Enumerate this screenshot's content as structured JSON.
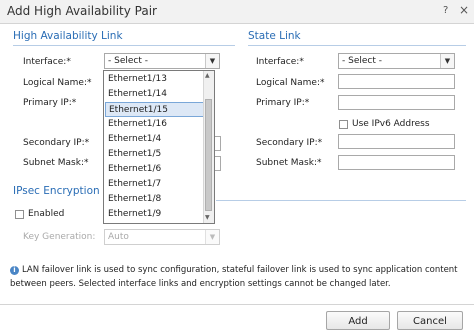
{
  "window": {
    "title": "Add High Availability Pair",
    "help_glyph": "?",
    "close_glyph": "×"
  },
  "ha_link": {
    "title": "High Availability Link",
    "interface_label": "Interface:*",
    "interface_value": "- Select -",
    "logical_name_label": "Logical Name:*",
    "primary_ip_label": "Primary IP:*",
    "secondary_ip_label": "Secondary IP:*",
    "subnet_mask_label": "Subnet Mask:*",
    "dropdown_options": [
      "Ethernet1/13",
      "Ethernet1/14",
      "Ethernet1/15",
      "Ethernet1/16",
      "Ethernet1/4",
      "Ethernet1/5",
      "Ethernet1/6",
      "Ethernet1/7",
      "Ethernet1/8",
      "Ethernet1/9"
    ],
    "dropdown_selected_index": 2
  },
  "state_link": {
    "title": "State Link",
    "interface_label": "Interface:*",
    "interface_value": "- Select -",
    "logical_name_label": "Logical Name:*",
    "primary_ip_label": "Primary IP:*",
    "use_ipv6_label": "Use IPv6 Address",
    "secondary_ip_label": "Secondary IP:*",
    "subnet_mask_label": "Subnet Mask:*"
  },
  "ipsec": {
    "title": "IPsec Encryption",
    "enabled_label": "Enabled",
    "key_generation_label": "Key Generation:",
    "key_generation_value": "Auto"
  },
  "info_text": "LAN failover link is used to sync configuration, stateful failover link is used to sync application content between peers. Selected interface links and encryption settings cannot be changed later.",
  "buttons": {
    "add": "Add",
    "cancel": "Cancel"
  }
}
